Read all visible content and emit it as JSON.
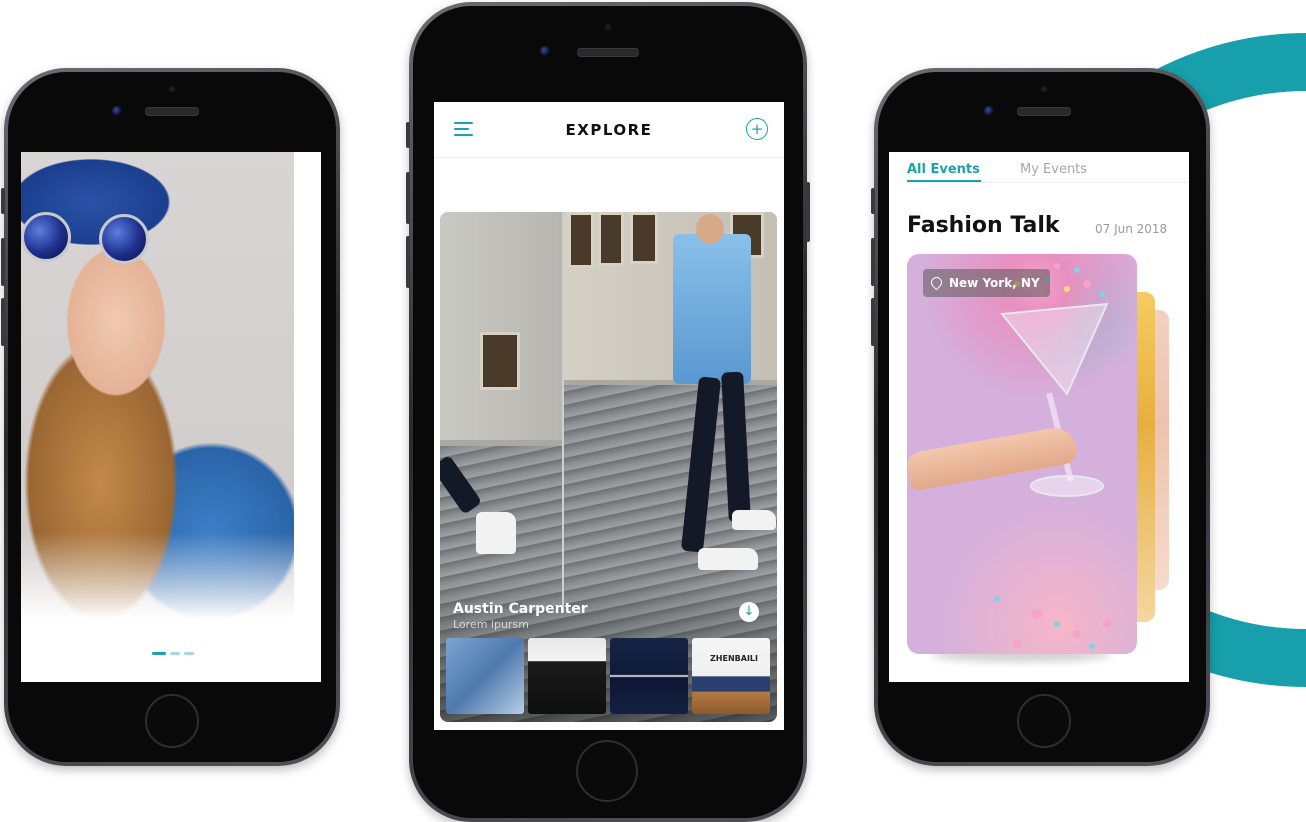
{
  "colors": {
    "accent": "#1ba2ad",
    "text": "#111111",
    "muted": "#9a9a9a"
  },
  "onboarding": {
    "page_indicator": {
      "count": 3,
      "active_index": 0
    }
  },
  "explore": {
    "title": "EXPLORE",
    "menu_icon": "menu-icon",
    "add_icon": "plus-circle-icon",
    "add_symbol": "+",
    "card": {
      "name": "Austin Carpenter",
      "subtitle": "Lorem ipursm",
      "download_icon": "arrow-down-circle-icon",
      "download_symbol": "↓",
      "thumbnails": [
        {
          "label": ""
        },
        {
          "label": ""
        },
        {
          "label": ""
        },
        {
          "label": "ZHENBAILI"
        }
      ]
    }
  },
  "events": {
    "tabs": [
      {
        "label": "All Events",
        "active": true
      },
      {
        "label": "My Events",
        "active": false
      }
    ],
    "title": "Fashion Talk",
    "date": "07 Jun 2018",
    "location": "New York, NY",
    "location_icon": "map-pin-icon"
  }
}
